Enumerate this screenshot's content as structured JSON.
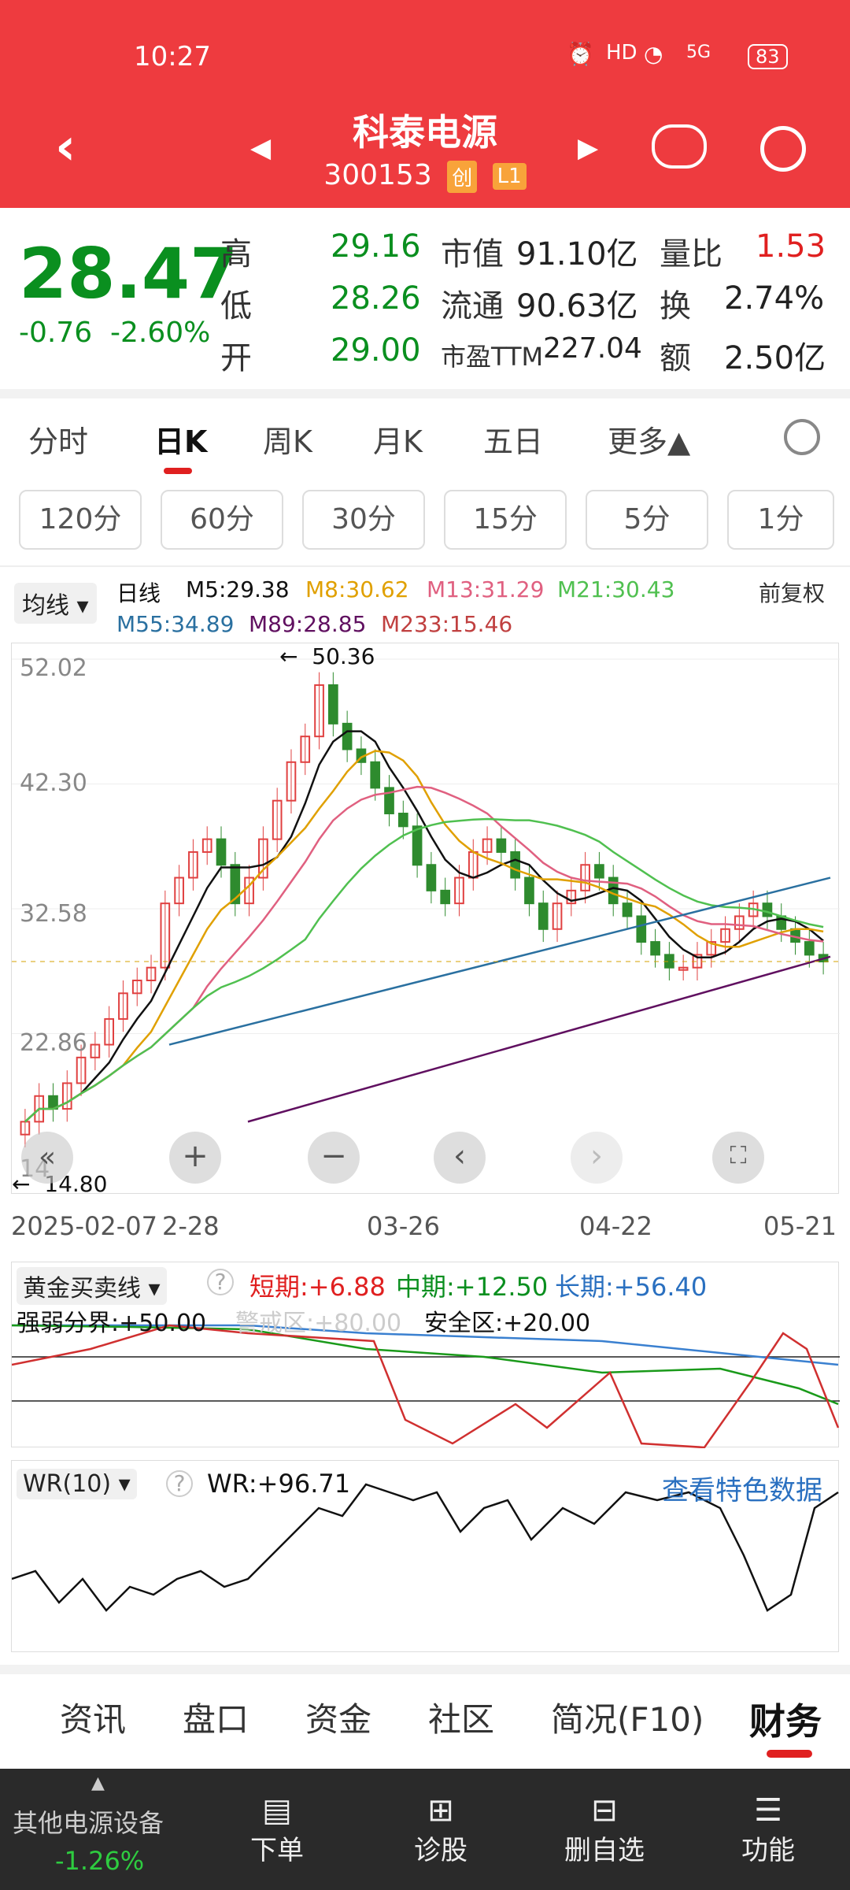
{
  "status": {
    "time": "10:27",
    "battery": "83",
    "network": "5G"
  },
  "nav": {
    "title": "科泰电源",
    "code": "300153",
    "tag1": "创",
    "tag2": "L1"
  },
  "quote": {
    "price": "28.47",
    "change": "-0.76",
    "change_pct": "-2.60%",
    "high_label": "高",
    "high": "29.16",
    "low_label": "低",
    "low": "28.26",
    "open_label": "开",
    "open": "29.00",
    "mcap_label": "市值",
    "mcap": "91.10亿",
    "float_label": "流通",
    "float": "90.63亿",
    "pe_label": "市盈TTM",
    "pe": "227.04",
    "vr_label": "量比",
    "vr": "1.53",
    "turn_label": "换",
    "turn": "2.74%",
    "amt_label": "额",
    "amt": "2.50亿"
  },
  "tabs": [
    "分时",
    "日K",
    "周K",
    "月K",
    "五日",
    "更多▲"
  ],
  "periods": [
    "120分",
    "60分",
    "30分",
    "15分",
    "5分",
    "1分"
  ],
  "ma": {
    "selector": "均线 ▾",
    "kind": "日线",
    "adj": "前复权",
    "m5": "M5:29.38",
    "m8": "M8:30.62",
    "m13": "M13:31.29",
    "m21": "M21:30.43",
    "m55": "M55:34.89",
    "m89": "M89:28.85",
    "m233": "M233:15.46"
  },
  "chart_labels": {
    "y_ticks": [
      "52.02",
      "42.30",
      "32.58",
      "22.86",
      "14"
    ],
    "max_marker": "50.36",
    "min_marker": "14.80",
    "x_ticks": [
      "2025-02-07",
      "2-28",
      "03-26",
      "04-22",
      "05-21"
    ]
  },
  "gold": {
    "selector": "黄金买卖线 ▾",
    "short": "短期:+6.88",
    "mid": "中期:+12.50",
    "long": "长期:+56.40",
    "bound": "强弱分界:+50.00",
    "hot": "警戒区:+80.00",
    "safe": "安全区:+20.00"
  },
  "wr": {
    "selector": "WR(10) ▾",
    "value": "WR:+96.71",
    "link": "查看特色数据"
  },
  "bottom_tabs": [
    "资讯",
    "盘口",
    "资金",
    "社区",
    "简况(F10)",
    "财务"
  ],
  "toolbar": {
    "sector": "其他电源设备",
    "sector_chg": "-1.26%",
    "items": [
      "下单",
      "诊股",
      "删自选",
      "功能"
    ]
  },
  "chart_data": {
    "type": "candlestick",
    "title": "",
    "ylim": [
      14.0,
      52.02
    ],
    "x_ticks": [
      "2025-02-07",
      "2-28",
      "03-26",
      "04-22",
      "05-21"
    ],
    "high_marker": 50.36,
    "low_marker": 14.8,
    "close_series": [
      16,
      18,
      17,
      19,
      21,
      22,
      24,
      26,
      27,
      28,
      33,
      35,
      37,
      38,
      36,
      33,
      35,
      38,
      41,
      44,
      46,
      50,
      47,
      45,
      44,
      42,
      40,
      39,
      36,
      34,
      33,
      35,
      37,
      38,
      37,
      35,
      33,
      31,
      33,
      34,
      36,
      35,
      33,
      32,
      30,
      29,
      28,
      28,
      29,
      30,
      31,
      32,
      33,
      32,
      31,
      30,
      29,
      28.47
    ],
    "series": [
      {
        "name": "M5",
        "value": 29.38,
        "color": "#111111"
      },
      {
        "name": "M8",
        "value": 30.62,
        "color": "#e0a000"
      },
      {
        "name": "M13",
        "value": 31.29,
        "color": "#e06080"
      },
      {
        "name": "M21",
        "value": 30.43,
        "color": "#50c050"
      },
      {
        "name": "M55",
        "value": 34.89,
        "color": "#2a70a0"
      },
      {
        "name": "M89",
        "value": 28.85,
        "color": "#601060"
      },
      {
        "name": "M233",
        "value": 15.46,
        "color": "#c04040"
      }
    ]
  }
}
